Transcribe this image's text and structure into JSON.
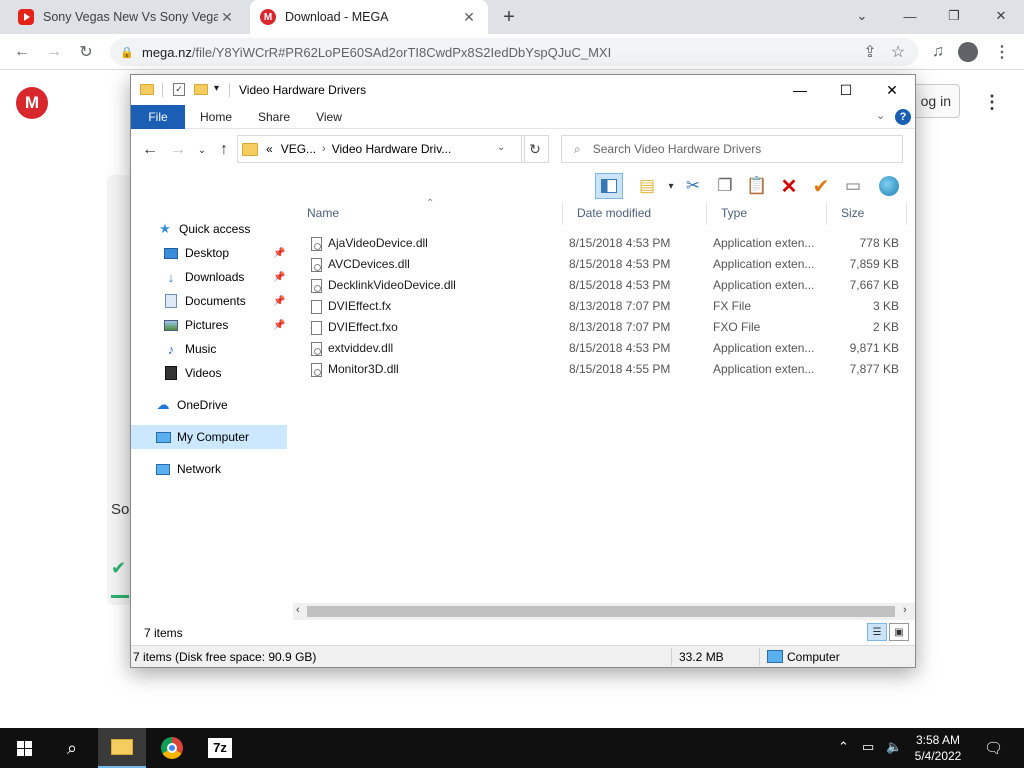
{
  "browser": {
    "tabs": [
      {
        "title": "Sony Vegas New Vs Sony Vegas Old",
        "close": "✕"
      },
      {
        "title": "Download - MEGA",
        "close": "✕"
      }
    ],
    "new_tab": "+",
    "url_host": "mega.nz",
    "url_rest": "/file/Y8YiWCrR#PR62LoPE60SAd2orTI8CwdPx8S2IedDbYspQJuC_MXI"
  },
  "mega": {
    "logo_letter": "M",
    "login_label": "og in",
    "card_text": "So"
  },
  "explorer": {
    "title": "Video Hardware Drivers",
    "ribbon_tabs": [
      "File",
      "Home",
      "Share",
      "View"
    ],
    "help": "?",
    "address": {
      "prefix": "«",
      "crumb1": "VEG...",
      "crumb2": "Video Hardware Driv..."
    },
    "search_placeholder": "Search Video Hardware Drivers",
    "nav": [
      {
        "label": "Quick access",
        "icon": "star-icon"
      },
      {
        "label": "Desktop",
        "icon": "desktop-icon",
        "pinned": true
      },
      {
        "label": "Downloads",
        "icon": "download-icon",
        "pinned": true
      },
      {
        "label": "Documents",
        "icon": "documents-icon",
        "pinned": true
      },
      {
        "label": "Pictures",
        "icon": "pictures-icon",
        "pinned": true
      },
      {
        "label": "Music",
        "icon": "music-icon"
      },
      {
        "label": "Videos",
        "icon": "videos-icon"
      },
      {
        "label": "OneDrive",
        "icon": "cloud-icon"
      },
      {
        "label": "My Computer",
        "icon": "computer-icon",
        "selected": true
      },
      {
        "label": "Network",
        "icon": "network-icon"
      }
    ],
    "columns": {
      "name": "Name",
      "date": "Date modified",
      "type": "Type",
      "size": "Size"
    },
    "files": [
      {
        "name": "AjaVideoDevice.dll",
        "date": "8/15/2018 4:53 PM",
        "type": "Application exten...",
        "size": "778 KB",
        "kind": "dll"
      },
      {
        "name": "AVCDevices.dll",
        "date": "8/15/2018 4:53 PM",
        "type": "Application exten...",
        "size": "7,859 KB",
        "kind": "dll"
      },
      {
        "name": "DecklinkVideoDevice.dll",
        "date": "8/15/2018 4:53 PM",
        "type": "Application exten...",
        "size": "7,667 KB",
        "kind": "dll"
      },
      {
        "name": "DVIEffect.fx",
        "date": "8/13/2018 7:07 PM",
        "type": "FX File",
        "size": "3 KB",
        "kind": "file"
      },
      {
        "name": "DVIEffect.fxo",
        "date": "8/13/2018 7:07 PM",
        "type": "FXO File",
        "size": "2 KB",
        "kind": "file"
      },
      {
        "name": "extviddev.dll",
        "date": "8/15/2018 4:53 PM",
        "type": "Application exten...",
        "size": "9,871 KB",
        "kind": "dll"
      },
      {
        "name": "Monitor3D.dll",
        "date": "8/15/2018 4:55 PM",
        "type": "Application exten...",
        "size": "7,877 KB",
        "kind": "dll"
      }
    ],
    "items_count": "7 items",
    "status": {
      "left": "7 items (Disk free space: 90.9 GB)",
      "size": "33.2 MB",
      "location": "Computer"
    }
  },
  "taskbar": {
    "time": "3:58 AM",
    "date": "5/4/2022",
    "seven_zip_label": "7z"
  },
  "colors": {
    "accent": "#1a5fb4",
    "mega_red": "#d9272e",
    "selection": "#cce8ff"
  }
}
